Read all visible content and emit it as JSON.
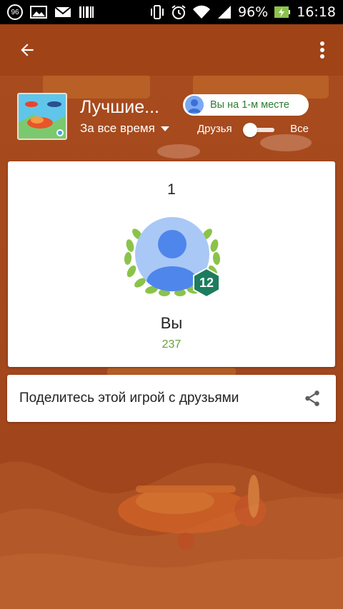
{
  "status_bar": {
    "notification_badge": "96",
    "battery": "96%",
    "time": "16:18"
  },
  "toolbar": {
    "back_icon": "arrow-back-icon",
    "menu_icon": "more-vert-icon"
  },
  "header": {
    "game_title": "Лучшие...",
    "time_filter": "За все время",
    "my_rank_chip": "Вы на 1-м месте",
    "toggle_left": "Друзья",
    "toggle_right": "Все"
  },
  "leaderboard": {
    "rank": "1",
    "player_name": "Вы",
    "score": "237",
    "level": "12"
  },
  "share": {
    "label": "Поделитесь этой игрой с друзьями",
    "icon": "share-icon"
  },
  "colors": {
    "background": "#a64a1f",
    "score_green": "#689f38",
    "chip_text": "#2e7d32",
    "level_badge": "#1d7c5e",
    "avatar_blue": "#4f86ec"
  }
}
